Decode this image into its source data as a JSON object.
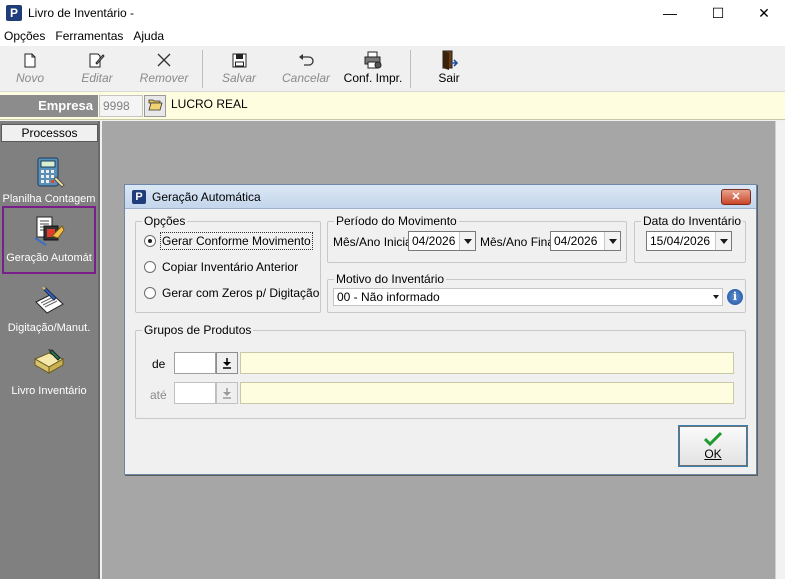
{
  "window": {
    "title": "Livro de Inventário -",
    "minimize_glyph": "—",
    "maximize_glyph": "☐",
    "close_glyph": "✕"
  },
  "menu": [
    "Opções",
    "Ferramentas",
    "Ajuda"
  ],
  "toolbar": {
    "novo": "Novo",
    "editar": "Editar",
    "remover": "Remover",
    "salvar": "Salvar",
    "cancelar": "Cancelar",
    "conf_impr": "Conf. Impr.",
    "sair": "Sair"
  },
  "empresa": {
    "label": "Empresa",
    "code": "9998",
    "name": "LUCRO REAL"
  },
  "sidebar": {
    "header": "Processos",
    "items": [
      {
        "label": "Planilha Contagem",
        "icon": "calculator-icon"
      },
      {
        "label": "Geração Automát",
        "icon": "auto-generate-icon",
        "selected": true
      },
      {
        "label": "Digitação/Manut.",
        "icon": "typing-icon"
      },
      {
        "label": "Livro Inventário",
        "icon": "book-icon"
      }
    ]
  },
  "dialog": {
    "title": "Geração Automática",
    "close_glyph": "✕",
    "opcoes": {
      "title": "Opções",
      "options": [
        "Gerar Conforme Movimento",
        "Copiar Inventário Anterior",
        "Gerar com Zeros p/ Digitação"
      ],
      "selected_index": 0
    },
    "periodo": {
      "title": "Período do Movimento",
      "inicial_label": "Mês/Ano Inicial",
      "inicial_value": "04/2026",
      "final_label": "Mês/Ano Final",
      "final_value": "04/2026"
    },
    "data_inventario": {
      "title": "Data do Inventário",
      "value": "15/04/2026"
    },
    "motivo": {
      "title": "Motivo do Inventário",
      "value": "00 - Não informado",
      "info_glyph": "i"
    },
    "grupos": {
      "title": "Grupos de Produtos",
      "de_label": "de",
      "ate_label": "até",
      "de_value": "",
      "ate_value": ""
    },
    "ok_label": "OK"
  }
}
